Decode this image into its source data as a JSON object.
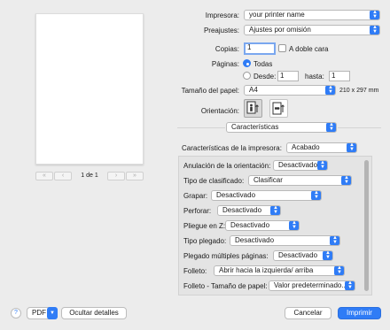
{
  "preview": {
    "page_label": "1 de 1",
    "first_icon": "double-chevron-left-icon",
    "prev_icon": "chevron-left-icon",
    "next_icon": "chevron-right-icon",
    "last_icon": "double-chevron-right-icon"
  },
  "printer": {
    "label": "Impresora:",
    "value": "your printer name"
  },
  "presets": {
    "label": "Preajustes:",
    "value": "Ajustes por omisión"
  },
  "copies": {
    "label": "Copias:",
    "value": "1",
    "duplex_label": "A doble cara"
  },
  "pages": {
    "label": "Páginas:",
    "all_label": "Todas",
    "from_label": "Desde:",
    "from_value": "1",
    "to_label": "hasta:",
    "to_value": "1"
  },
  "paper": {
    "label": "Tamaño del papel:",
    "value": "A4",
    "dims": "210 x 297 mm"
  },
  "orientation": {
    "label": "Orientación:"
  },
  "section": {
    "value": "Características"
  },
  "features": {
    "label": "Características de la impresora:",
    "value": "Acabado",
    "rows": [
      {
        "label": "Anulación de la orientación:",
        "value": "Desactivado"
      },
      {
        "label": "Tipo de clasificado:",
        "value": "Clasificar"
      },
      {
        "label": "Grapar:",
        "value": "Desactivado"
      },
      {
        "label": "Perforar:",
        "value": "Desactivado"
      },
      {
        "label": "Pliegue en Z:",
        "value": "Desactivado"
      },
      {
        "label": "Tipo plegado:",
        "value": "Desactivado"
      },
      {
        "label": "Plegado múltiples páginas:",
        "value": "Desactivado"
      },
      {
        "label": "Folleto:",
        "value": "Abrir hacia la izquierda/ arriba"
      },
      {
        "label": "Folleto - Tamaño de papel:",
        "value": "Valor predeterminado..."
      }
    ]
  },
  "footer": {
    "help": "?",
    "pdf": "PDF",
    "hide": "Ocultar detalles",
    "cancel": "Cancelar",
    "print": "Imprimir"
  },
  "colors": {
    "accent": "#2f7cf6",
    "background": "#ececec"
  }
}
